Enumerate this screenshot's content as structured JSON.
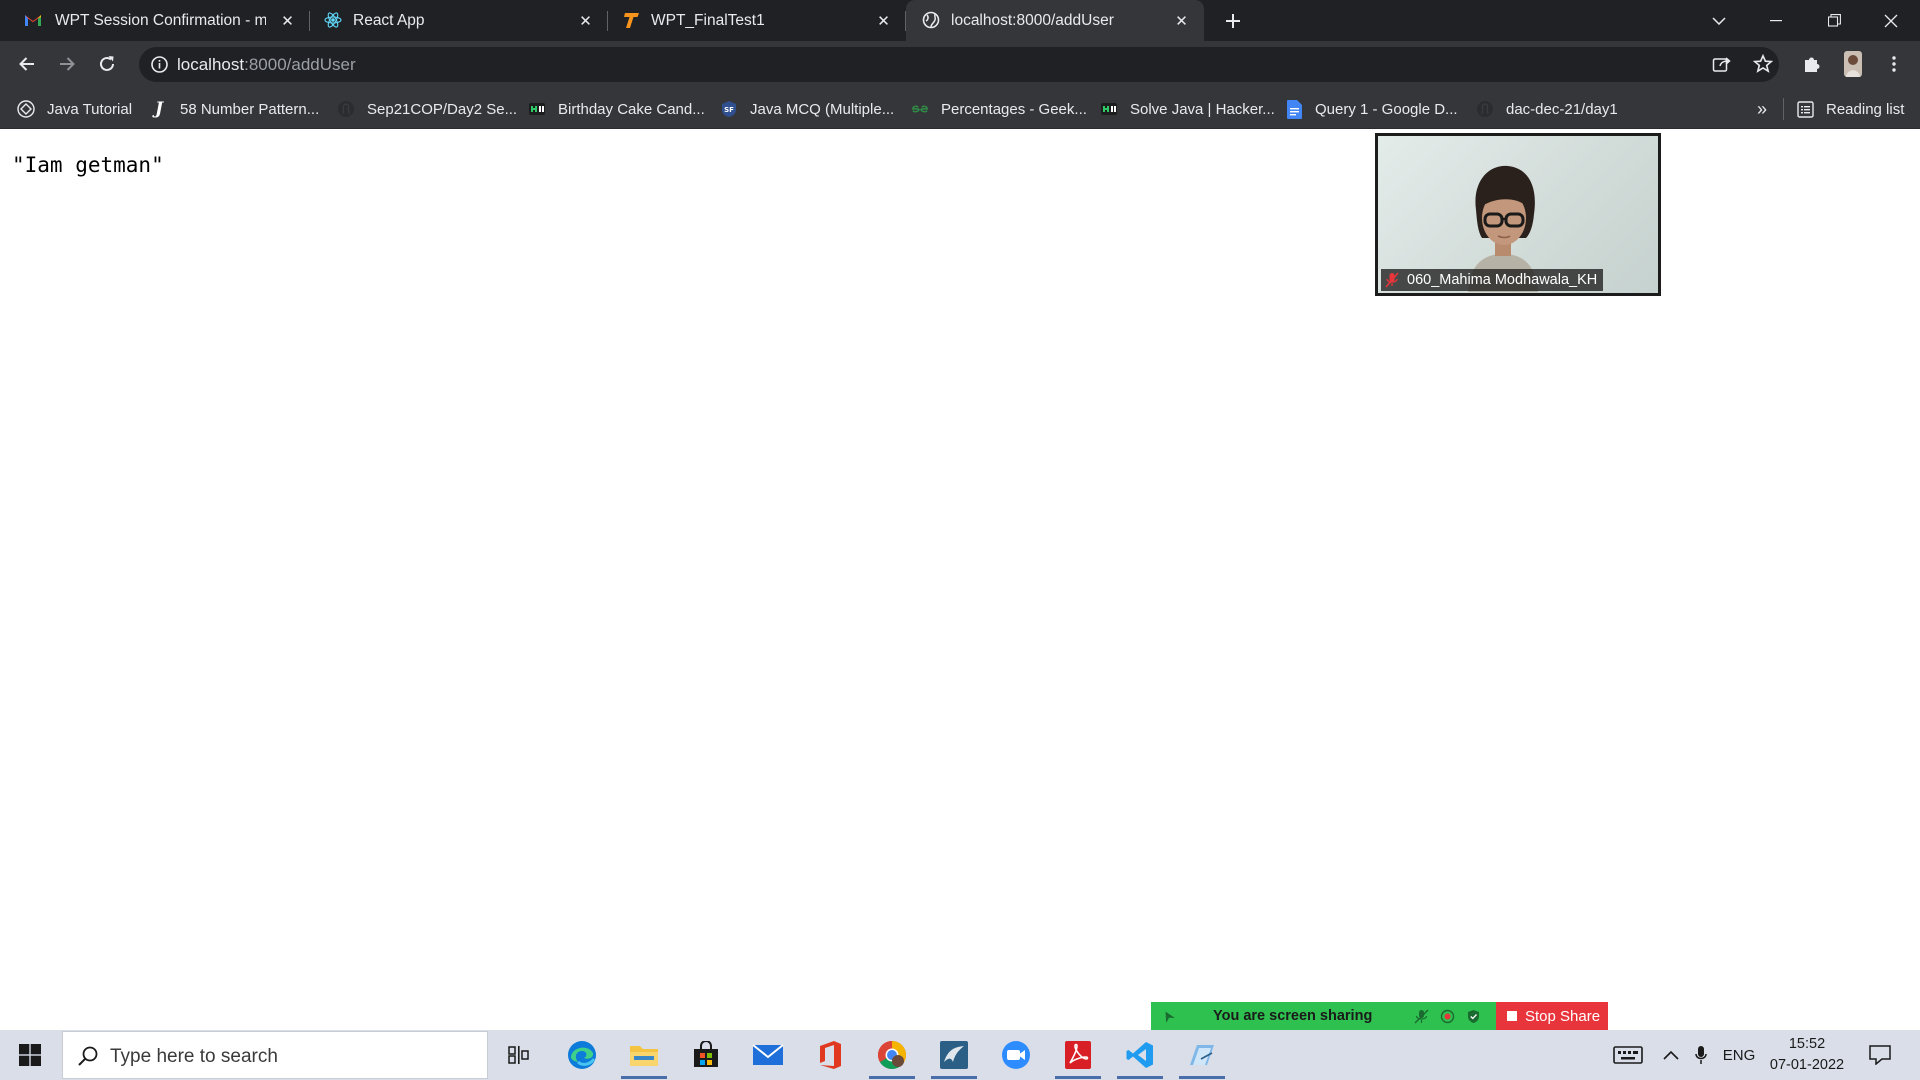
{
  "browser": {
    "tabs": [
      {
        "title": "WPT Session Confirmation - mahima",
        "icon": "gmail-icon",
        "active": false
      },
      {
        "title": "React App",
        "icon": "react-icon",
        "active": false
      },
      {
        "title": "WPT_FinalTest1",
        "icon": "testbook-icon",
        "active": false
      },
      {
        "title": "localhost:8000/addUser",
        "icon": "globe-icon",
        "active": true
      }
    ],
    "address": {
      "host": "localhost",
      "path": ":8000/addUser"
    },
    "bookmarks": [
      {
        "label": "Java Tutorial",
        "icon": "javatpoint-icon"
      },
      {
        "label": "58 Number Pattern...",
        "icon": "j-letter-icon"
      },
      {
        "label": "Sep21COP/Day2 Se...",
        "icon": "github-icon"
      },
      {
        "label": "Birthday Cake Cand...",
        "icon": "hackerrank-icon"
      },
      {
        "label": "Java MCQ (Multiple...",
        "icon": "sanfoundry-icon"
      },
      {
        "label": "Percentages - Geek...",
        "icon": "geeksforgeeks-icon"
      },
      {
        "label": "Solve Java | Hacker...",
        "icon": "hackerrank-icon"
      },
      {
        "label": "Query 1 - Google D...",
        "icon": "google-docs-icon"
      },
      {
        "label": "dac-dec-21/day1",
        "icon": "github-icon"
      }
    ],
    "bookmarks_overflow": "»",
    "reading_list": "Reading list"
  },
  "page": {
    "response_text": "\"Iam getman\""
  },
  "video": {
    "participant_name": "060_Mahima Modhawala_KH"
  },
  "screen_share": {
    "status": "You are screen sharing",
    "stop_label": "Stop Share",
    "accent_green": "#2fc150",
    "accent_red": "#e8343b"
  },
  "taskbar": {
    "search_placeholder": "Type here to search",
    "language": "ENG",
    "time": "15:52",
    "date": "07-01-2022"
  }
}
